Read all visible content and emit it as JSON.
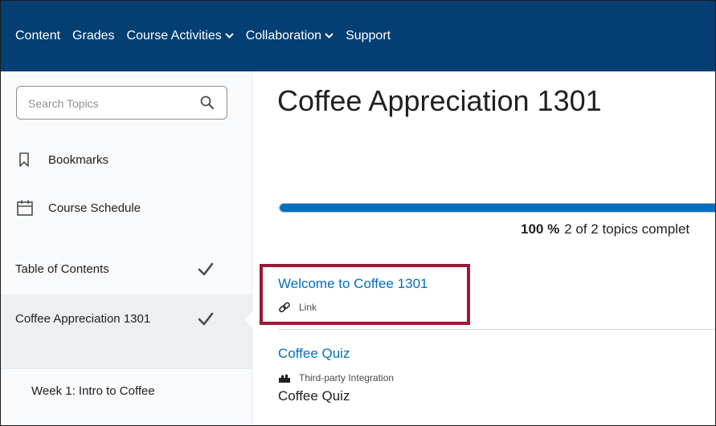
{
  "nav": {
    "items": [
      {
        "label": "Content",
        "dropdown": false
      },
      {
        "label": "Grades",
        "dropdown": false
      },
      {
        "label": "Course Activities",
        "dropdown": true
      },
      {
        "label": "Collaboration",
        "dropdown": true
      },
      {
        "label": "Support",
        "dropdown": false
      }
    ],
    "background": "#033f73"
  },
  "sidebar": {
    "search": {
      "placeholder": "Search Topics",
      "value": "",
      "icon": "search-icon"
    },
    "links": [
      {
        "label": "Bookmarks",
        "icon": "bookmark-icon"
      },
      {
        "label": "Course Schedule",
        "icon": "calendar-icon"
      }
    ],
    "toc": [
      {
        "label": "Table of Contents",
        "completed": true
      },
      {
        "label": "Coffee Appreciation 1301",
        "completed": true,
        "active": true
      }
    ],
    "modules": [
      {
        "label": "Week 1: Intro to Coffee"
      }
    ]
  },
  "main": {
    "title": "Coffee Appreciation 1301",
    "progress": {
      "percent_label": "100 %",
      "summary": "2 of 2 topics complet",
      "fraction": 1.0,
      "fill_color": "#006fbf"
    },
    "topics": [
      {
        "title": "Welcome to Coffee 1301",
        "type": "Link",
        "type_icon": "link-icon",
        "highlighted": true
      },
      {
        "title": "Coffee Quiz",
        "type": "Third-party Integration",
        "type_icon": "puzzle-icon",
        "subtitle": "Coffee Quiz"
      }
    ],
    "highlight_color": "#9a1b35"
  }
}
